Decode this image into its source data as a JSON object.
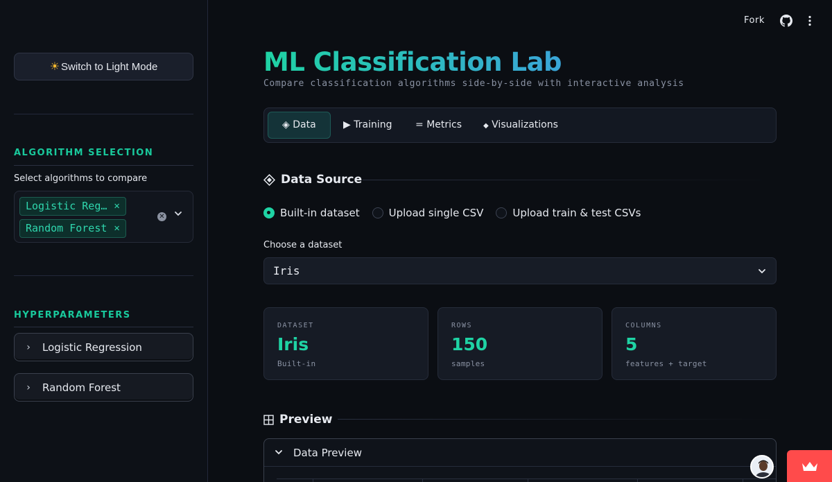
{
  "sidebar": {
    "theme_button": "Switch to Light Mode",
    "algorithm_section": "ALGORITHM SELECTION",
    "algorithm_label": "Select algorithms to compare",
    "selected_algorithms": [
      "Logistic Reg…",
      "Random Forest"
    ],
    "hyperparameters_section": "HYPERPARAMETERS",
    "expanders": [
      "Logistic Regression",
      "Random Forest"
    ]
  },
  "header": {
    "fork": "Fork",
    "icons": [
      "github-icon",
      "kebab-menu-icon"
    ]
  },
  "main": {
    "title": "ML Classification Lab",
    "subtitle": "Compare classification algorithms side-by-side with interactive analysis",
    "tabs": [
      {
        "icon": "◈",
        "label": "Data"
      },
      {
        "icon": "▶",
        "label": "Training"
      },
      {
        "icon": "=",
        "label": "Metrics"
      },
      {
        "icon": "◆",
        "label": "Visualizations"
      }
    ],
    "data_source_heading": "Data Source",
    "radio_options": [
      "Built-in dataset",
      "Upload single CSV",
      "Upload train & test CSVs"
    ],
    "selected_radio": 0,
    "dataset_label": "Choose a dataset",
    "dataset_value": "Iris",
    "cards": [
      {
        "label": "DATASET",
        "value": "Iris",
        "sub": "Built-in"
      },
      {
        "label": "ROWS",
        "value": "150",
        "sub": "samples"
      },
      {
        "label": "COLUMNS",
        "value": "5",
        "sub": "features + target"
      }
    ],
    "preview_heading": "Preview",
    "preview_expander": "Data Preview"
  },
  "colors": {
    "accent": "#1fd3a4",
    "accent_secondary": "#3aa5d8",
    "background": "#0b0e13",
    "deploy_red": "#ff4b4b"
  }
}
